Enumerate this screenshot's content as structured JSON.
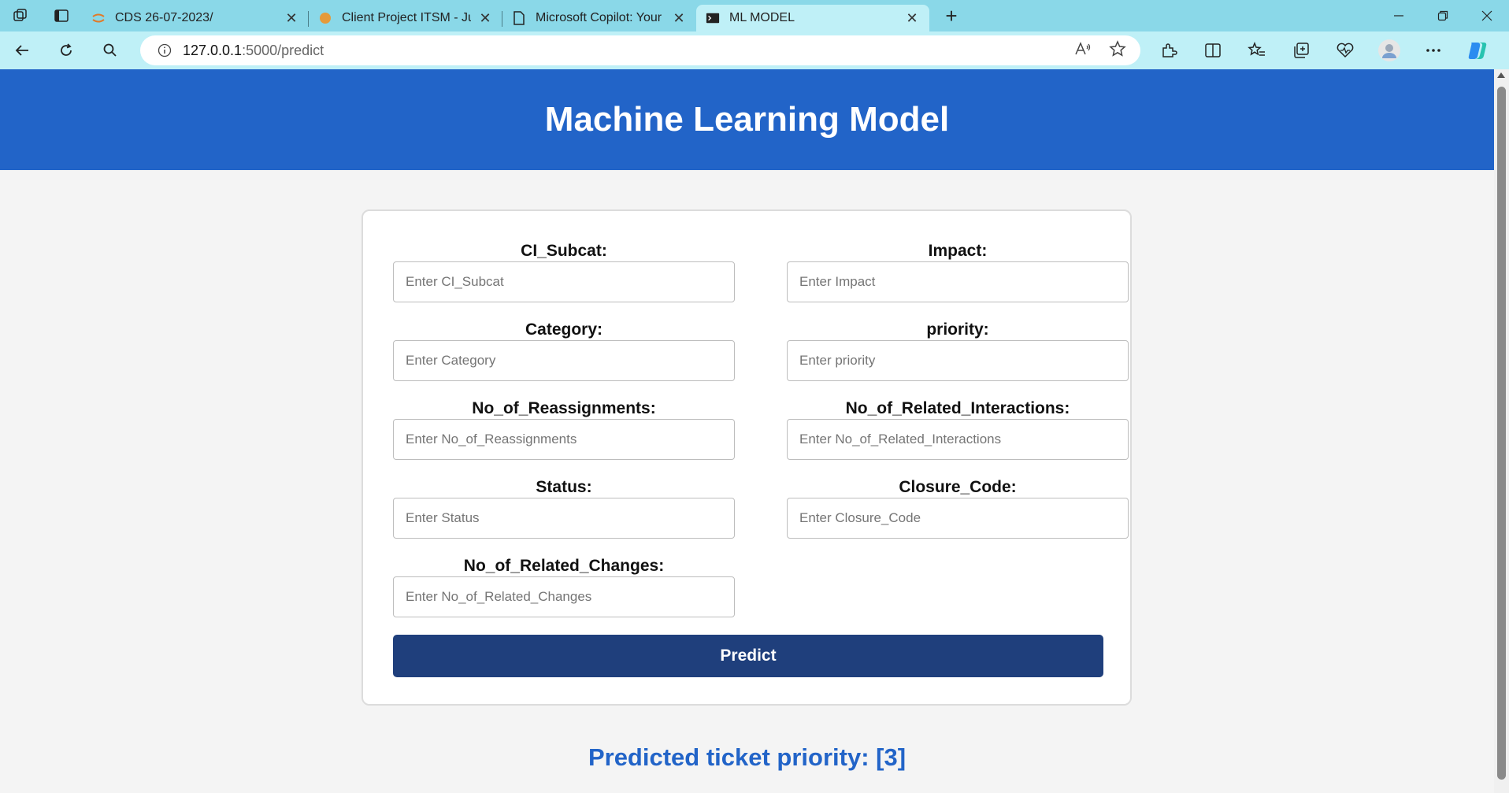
{
  "browser": {
    "tabs": [
      {
        "title": "CDS 26-07-2023/",
        "icon": "jupyter-icon",
        "active": false
      },
      {
        "title": "Client Project ITSM - Jupyter Not",
        "icon": "jupyter-orange-icon",
        "active": false
      },
      {
        "title": "Microsoft Copilot: Your everyday",
        "icon": "page-icon",
        "active": false
      },
      {
        "title": "ML MODEL",
        "icon": "terminal-icon",
        "active": true
      }
    ],
    "close_glyph": "✕",
    "new_tab_glyph": "+",
    "address": {
      "host": "127.0.0.1",
      "path": ":5000/predict"
    },
    "colors": {
      "tabbar": "#8ad8e8",
      "toolbar": "#bff0f7"
    }
  },
  "page": {
    "title": "Machine Learning Model",
    "form": {
      "fields": [
        {
          "label": "CI_Subcat:",
          "placeholder": "Enter CI_Subcat"
        },
        {
          "label": "Impact:",
          "placeholder": "Enter Impact"
        },
        {
          "label": "Category:",
          "placeholder": "Enter Category"
        },
        {
          "label": "priority:",
          "placeholder": "Enter priority"
        },
        {
          "label": "No_of_Reassignments:",
          "placeholder": "Enter No_of_Reassignments"
        },
        {
          "label": "No_of_Related_Interactions:",
          "placeholder": "Enter No_of_Related_Interactions"
        },
        {
          "label": "Status:",
          "placeholder": "Enter Status"
        },
        {
          "label": "Closure_Code:",
          "placeholder": "Enter Closure_Code"
        },
        {
          "label": "No_of_Related_Changes:",
          "placeholder": "Enter No_of_Related_Changes"
        }
      ],
      "submit_label": "Predict"
    },
    "result": "Predicted ticket priority: [3]",
    "colors": {
      "header": "#2264c8",
      "button": "#1f3f7c",
      "result_text": "#2264c8"
    }
  }
}
